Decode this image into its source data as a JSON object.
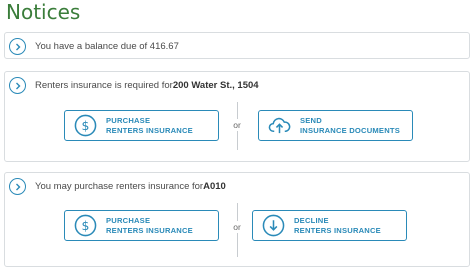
{
  "page": {
    "title": "Notices"
  },
  "notices": [
    {
      "text_parts": [
        "You have a balance due of 416.67"
      ]
    },
    {
      "text_plain": "Renters insurance is required for ",
      "text_bold": "200 Water St., 1504",
      "left_button": {
        "line1": "PURCHASE",
        "line2": "RENTERS INSURANCE",
        "icon": "dollar-circle-icon"
      },
      "or_label": "or",
      "right_button": {
        "line1": "SEND",
        "line2": "INSURANCE DOCUMENTS",
        "icon": "cloud-upload-icon"
      }
    },
    {
      "text_plain": "You may purchase renters insurance for ",
      "text_bold": "A010",
      "left_button": {
        "line1": "PURCHASE",
        "line2": "RENTERS INSURANCE",
        "icon": "dollar-circle-icon"
      },
      "or_label": "or",
      "right_button": {
        "line1": "DECLINE",
        "line2": "RENTERS INSURANCE",
        "icon": "download-circle-icon"
      }
    }
  ],
  "colors": {
    "accent": "#2a8ab8",
    "title": "#3a7d3a",
    "border": "#d9dde0"
  }
}
